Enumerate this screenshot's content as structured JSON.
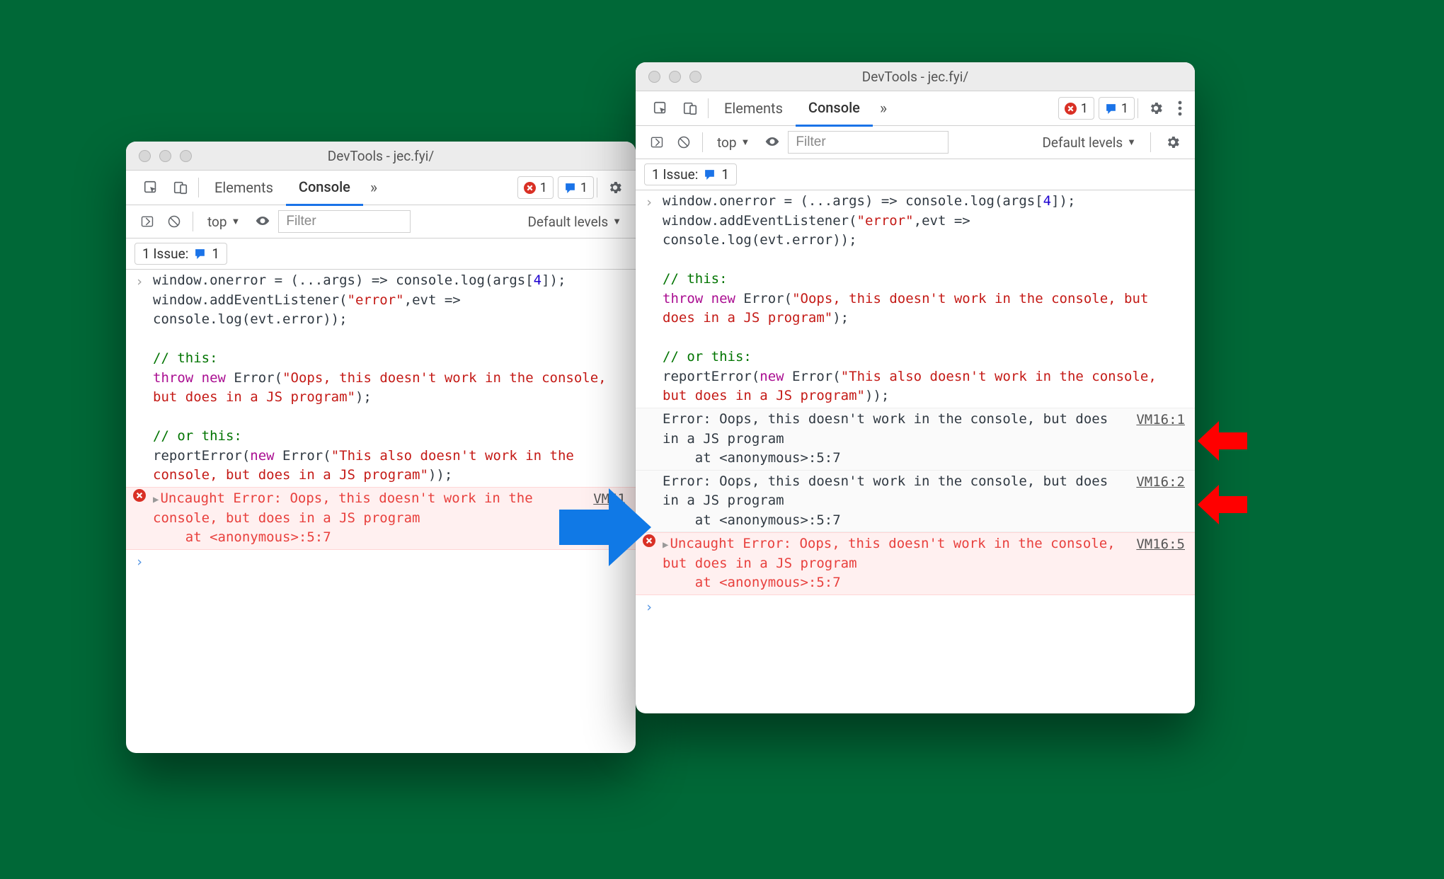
{
  "shared": {
    "window_title": "DevTools - jec.fyi/",
    "tabs": {
      "elements": "Elements",
      "console": "Console"
    },
    "badges": {
      "errors": "1",
      "messages": "1"
    },
    "toolbar": {
      "context": "top",
      "filter_placeholder": "Filter",
      "levels": "Default levels"
    },
    "issues": {
      "label": "1 Issue:",
      "count": "1"
    },
    "code_lines": [
      [
        {
          "t": "window.onerror = (...args) => console.log(args["
        },
        {
          "t": "4",
          "c": "num"
        },
        {
          "t": "]);"
        }
      ],
      [
        {
          "t": "window.addEventListener("
        },
        {
          "t": "\"error\"",
          "c": "str"
        },
        {
          "t": ",evt =>"
        }
      ],
      [
        {
          "t": "console.log(evt.error));"
        }
      ],
      [
        {
          "t": " "
        }
      ],
      [
        {
          "t": "// this:",
          "c": "cmt"
        }
      ],
      [
        {
          "t": "throw",
          "c": "kw"
        },
        {
          "t": " "
        },
        {
          "t": "new",
          "c": "kw"
        },
        {
          "t": " Error("
        },
        {
          "t": "\"Oops, this doesn't work in the console, but does in a JS program\"",
          "c": "str"
        },
        {
          "t": ");"
        }
      ],
      [
        {
          "t": " "
        }
      ],
      [
        {
          "t": "// or this:",
          "c": "cmt"
        }
      ],
      [
        {
          "t": "reportError("
        },
        {
          "t": "new",
          "c": "kw"
        },
        {
          "t": " Error("
        },
        {
          "t": "\"This also doesn't work in the console, but does in a JS program\"",
          "c": "str"
        },
        {
          "t": "));"
        }
      ]
    ],
    "error_text": "Uncaught Error: Oops, this doesn't work in the console, but does in a JS program\n    at <anonymous>:5:7",
    "log_text": "Error: Oops, this doesn't work in the console, but does in a JS program\n    at <anonymous>:5:7"
  },
  "left": {
    "error_src": "VM41",
    "filter_width": 165
  },
  "right": {
    "log_src_1": "VM16:1",
    "log_src_2": "VM16:2",
    "error_src": "VM16:5",
    "filter_width": 205
  }
}
